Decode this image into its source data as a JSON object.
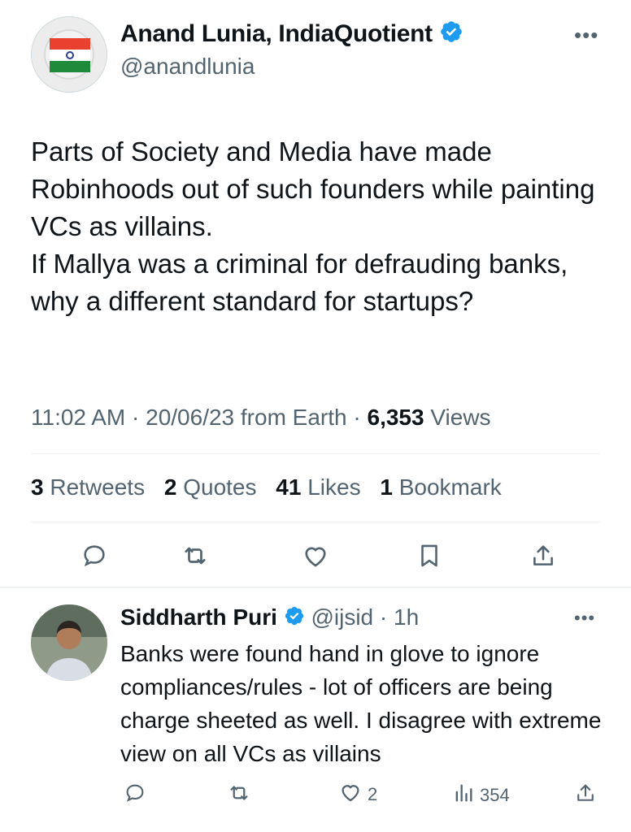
{
  "tweet": {
    "author": {
      "name": "Anand Lunia, IndiaQuotient",
      "handle": "@anandlunia",
      "verified_icon": "verified-badge-icon"
    },
    "more_icon": "more-options-icon",
    "text": "Parts of Society and Media have made Robinhoods out of such founders while painting VCs as villains.\nIf Mallya was a criminal for defrauding banks, why a different standard for startups?",
    "time": "11:02 AM",
    "date": "20/06/23",
    "source": "from Earth",
    "views_count": "6,353",
    "views_label": "Views",
    "stats": {
      "retweets_count": "3",
      "retweets_label": "Retweets",
      "quotes_count": "2",
      "quotes_label": "Quotes",
      "likes_count": "41",
      "likes_label": "Likes",
      "bookmarks_count": "1",
      "bookmarks_label": "Bookmark"
    },
    "actions": [
      "reply-icon",
      "retweet-icon",
      "like-icon",
      "bookmark-icon",
      "share-icon"
    ]
  },
  "reply": {
    "author": {
      "name": "Siddharth Puri",
      "handle": "@ijsid",
      "age": "1h"
    },
    "text": "Banks were found hand in glove to ignore compliances/rules - lot of officers are being charge sheeted as well. I disagree with extreme view on all VCs as villains",
    "likes_count": "2",
    "views_count": "354"
  },
  "colors": {
    "primary_text": "#0f1419",
    "secondary_text": "#536471",
    "verified_blue": "#1d9bf0",
    "divider": "#eff3f4"
  }
}
